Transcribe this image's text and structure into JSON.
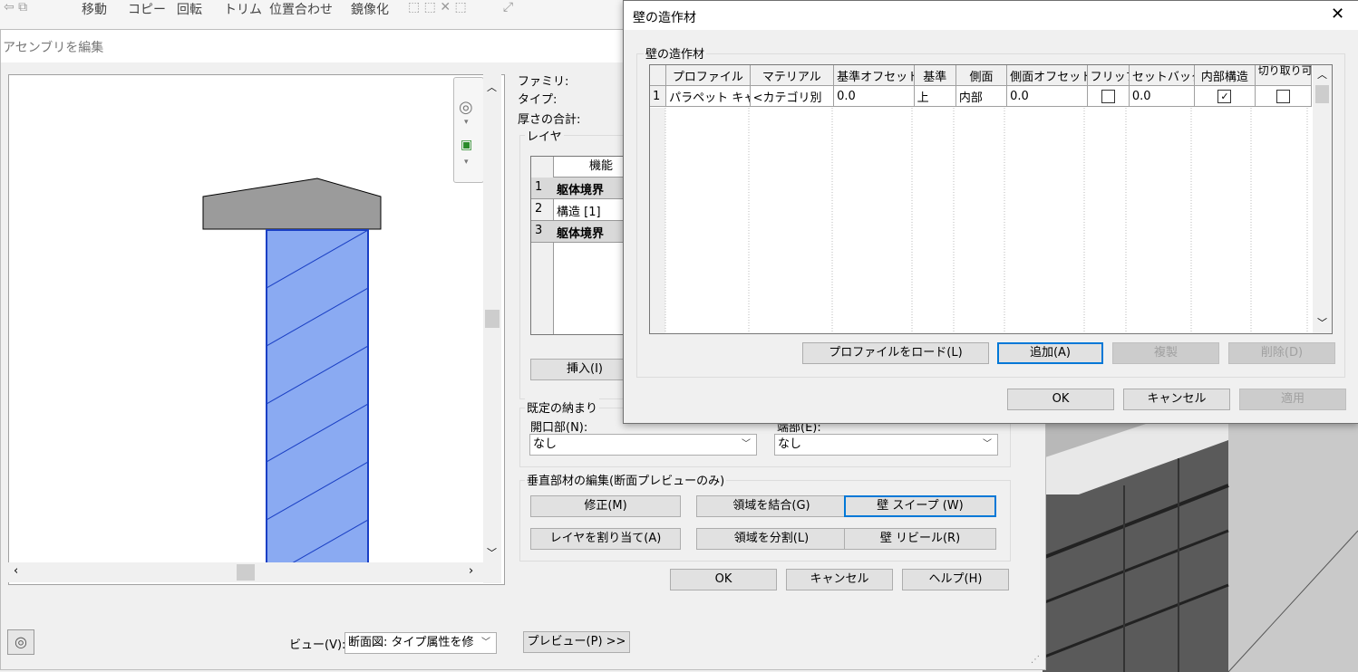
{
  "ribbon": {
    "items": [
      "移動",
      "コピー",
      "回転",
      "トリム",
      "位置合わせ",
      "鏡像化"
    ]
  },
  "assembly": {
    "title": "アセンブリを編集",
    "props": {
      "family": "ファミリ:",
      "type": "タイプ:",
      "total_thickness": "厚さの合計:"
    },
    "layers": {
      "group_title": "レイヤ",
      "col_function": "機能",
      "rows": [
        {
          "num": "1",
          "func": "躯体境界",
          "bold": true
        },
        {
          "num": "2",
          "func": "構造 [1]",
          "bold": false
        },
        {
          "num": "3",
          "func": "躯体境界",
          "bold": true
        }
      ],
      "insert_button": "挿入(I)"
    },
    "wrapping": {
      "group_title": "既定の納まり",
      "at_inserts_label": "開口部(N):",
      "at_inserts_value": "なし",
      "at_ends_label": "端部(E):",
      "at_ends_value": "なし"
    },
    "vertical": {
      "group_title": "垂直部材の編集(断面プレビューのみ)",
      "modify": "修正(M)",
      "merge": "領域を結合(G)",
      "sweeps": "壁 スイープ (W)",
      "assign": "レイヤを割り当て(A)",
      "split": "領域を分割(L)",
      "reveals": "壁 リビール(R)"
    },
    "ok": "OK",
    "cancel": "キャンセル",
    "help": "ヘルプ(H)",
    "view_label": "ビュー(V):",
    "view_value": "断面図: タイプ属性を修",
    "preview_button": "プレビュー(P) >>"
  },
  "wall_sweeps": {
    "title": "壁の造作材",
    "group_title": "壁の造作材",
    "columns": [
      "プロファイル",
      "マテリアル",
      "基準オフセット",
      "基準",
      "側面",
      "側面オフセット",
      "フリップ",
      "セットバック",
      "内部構造",
      "切り取り可能"
    ],
    "rows": [
      {
        "num": "1",
        "profile": "パラペット キャッ",
        "material": "<カテゴリ別",
        "offset": "0.0",
        "from": "上",
        "side": "内部",
        "side_offset": "0.0",
        "flip": false,
        "setback": "0.0",
        "inner": true,
        "cuts": false
      }
    ],
    "load_profile": "プロファイルをロード(L)",
    "add": "追加(A)",
    "duplicate": "複製",
    "delete": "削除(D)",
    "ok": "OK",
    "cancel": "キャンセル",
    "apply": "適用"
  },
  "colors": {
    "layer_fill": "#8aaaf2",
    "layer_stroke": "#1a3fc4",
    "cap_fill": "#9b9b9b",
    "focus": "#0078d7"
  }
}
